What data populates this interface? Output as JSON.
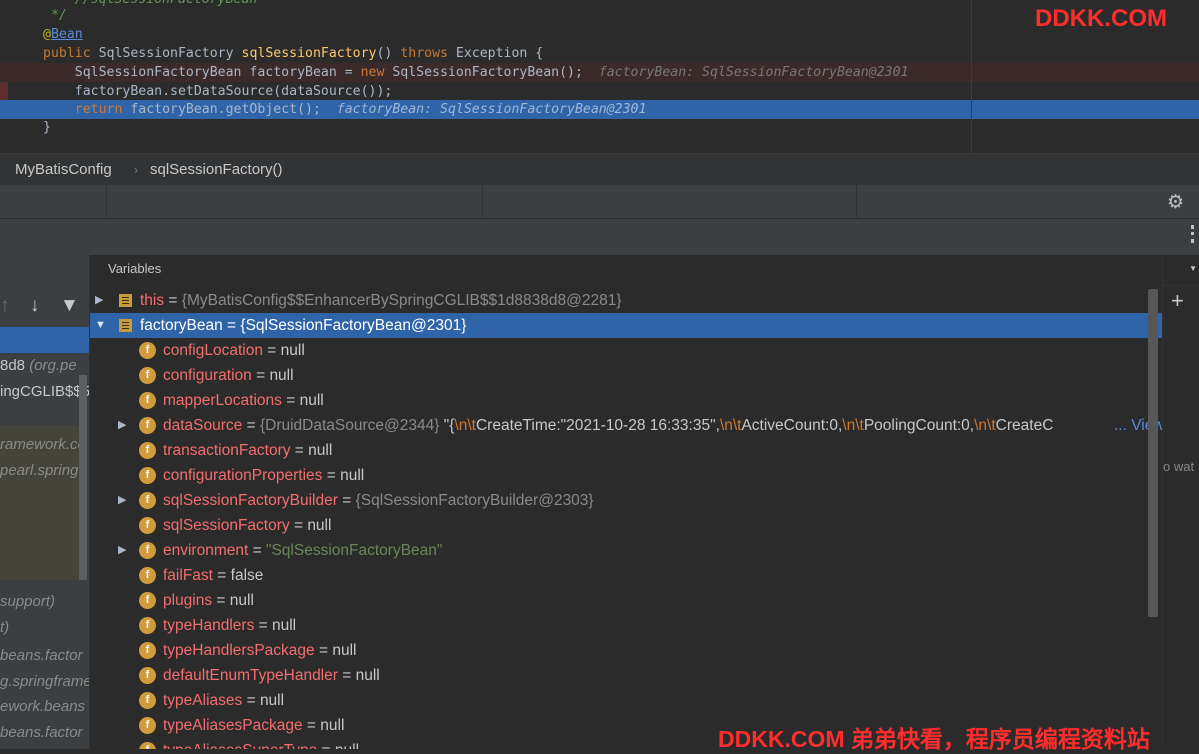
{
  "editor": {
    "comment_line1": "    //sqlSessionFactoryBean",
    "comment_line2": " */",
    "annotation_at": "@",
    "annotation_name": "Bean",
    "sig_public": "public ",
    "sig_type": "SqlSessionFactory ",
    "sig_method": "sqlSessionFactory",
    "sig_params": "() ",
    "sig_throws": "throws ",
    "sig_exception": "Exception {",
    "l1_decl": "    SqlSessionFactoryBean factoryBean = ",
    "l1_new": "new ",
    "l1_ctor": "SqlSessionFactoryBean();",
    "l1_inline": "  factoryBean: SqlSessionFactoryBean@2301",
    "l2": "    factoryBean.setDataSource(dataSource());",
    "l3_return": "    return ",
    "l3_call": "factoryBean.getObject();",
    "l3_inline": "  factoryBean: SqlSessionFactoryBean@2301",
    "close": "}"
  },
  "watermark_top": "DDKK.COM",
  "watermark_bottom": "DDKK.COM 弟弟快看，程序员编程资料站",
  "breadcrumb": {
    "class_name": "MyBatisConfig",
    "separator": "›",
    "method": "sqlSessionFactory()"
  },
  "icons": {
    "settings": "gear-icon",
    "add_watch": "plus-icon",
    "up": "arrow-up-icon",
    "down": "arrow-down-icon",
    "filter": "filter-icon"
  },
  "frames": {
    "items": [
      {
        "main": "8d8",
        "dim": " (org.pe"
      },
      {
        "main": "ingCGLIB$$5",
        "dim": ""
      },
      {
        "main": "",
        "dim": "ramework.co"
      },
      {
        "main": "",
        "dim": "pearl.spring."
      },
      {
        "main": "",
        "dim": "support)"
      },
      {
        "main": "",
        "dim": "t)"
      },
      {
        "main": "",
        "dim": "beans.factor"
      },
      {
        "main": "",
        "dim": "g.springframe"
      },
      {
        "main": "",
        "dim": "ework.beans"
      },
      {
        "main": "",
        "dim": "beans.factor"
      }
    ]
  },
  "variables": {
    "title": "Variables",
    "this_name": "this",
    "this_eq": " = ",
    "this_val": "{MyBatisConfig$$EnhancerBySpringCGLIB$$1d8838d8@2281}",
    "fb_name": "factoryBean",
    "fb_eq": " = ",
    "fb_val": "{SqlSessionFactoryBean@2301}",
    "fields": [
      {
        "name": "configLocation",
        "eq": " = ",
        "val": "null"
      },
      {
        "name": "configuration",
        "eq": " = ",
        "val": "null"
      },
      {
        "name": "mapperLocations",
        "eq": " = ",
        "val": "null"
      },
      {
        "name": "dataSource",
        "eq": " = ",
        "type": "{DruidDataSource@2344} ",
        "q": "\"{",
        "e1": "\\n\\t",
        "s1": "CreateTime:\"2021-10-28 16:33:35\",",
        "e2": "\\n\\t",
        "s2": "ActiveCount:0,",
        "e3": "\\n\\t",
        "s3": "PoolingCount:0,",
        "e4": "\\n\\t",
        "s4": "CreateC",
        "more": "... View"
      },
      {
        "name": "transactionFactory",
        "eq": " = ",
        "val": "null"
      },
      {
        "name": "configurationProperties",
        "eq": " = ",
        "val": "null"
      },
      {
        "name": "sqlSessionFactoryBuilder",
        "eq": " = ",
        "type": "{SqlSessionFactoryBuilder@2303}"
      },
      {
        "name": "sqlSessionFactory",
        "eq": " = ",
        "val": "null"
      },
      {
        "name": "environment",
        "eq": " = ",
        "str": "\"SqlSessionFactoryBean\""
      },
      {
        "name": "failFast",
        "eq": " = ",
        "val": "false"
      },
      {
        "name": "plugins",
        "eq": " = ",
        "val": "null"
      },
      {
        "name": "typeHandlers",
        "eq": " = ",
        "val": "null"
      },
      {
        "name": "typeHandlersPackage",
        "eq": " = ",
        "val": "null"
      },
      {
        "name": "defaultEnumTypeHandler",
        "eq": " = ",
        "val": "null"
      },
      {
        "name": "typeAliases",
        "eq": " = ",
        "val": "null"
      },
      {
        "name": "typeAliasesPackage",
        "eq": " = ",
        "val": "null"
      },
      {
        "name": "typeAliasesSuperType",
        "eq": " = ",
        "val": "null"
      }
    ],
    "field_badge": "f"
  },
  "watches": {
    "partial_text": "o wat"
  }
}
